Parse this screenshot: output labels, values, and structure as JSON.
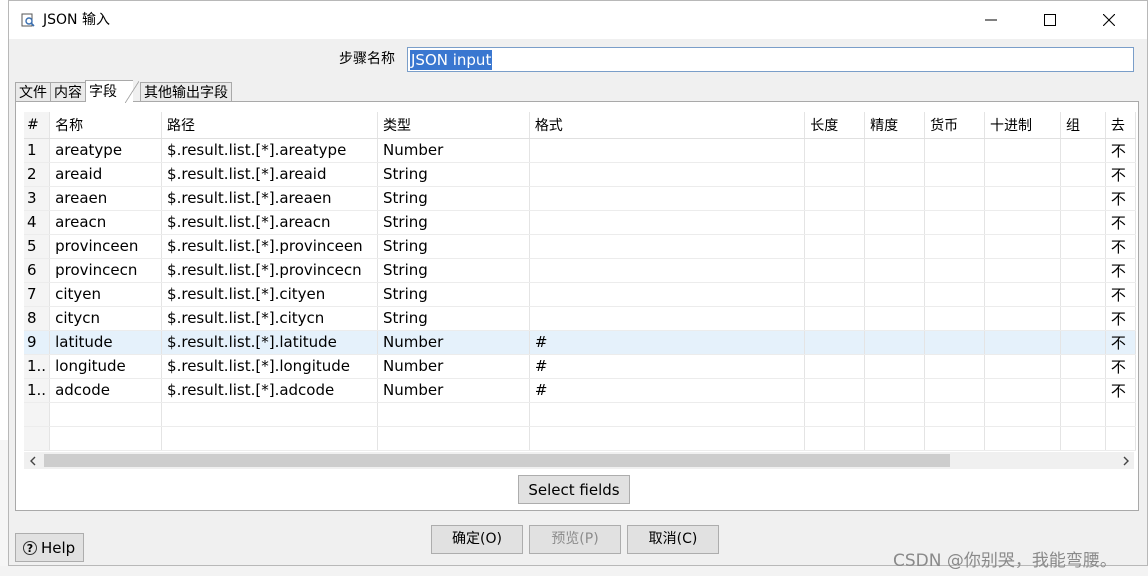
{
  "window": {
    "title": "JSON 输入"
  },
  "step": {
    "label": "步骤名称",
    "value": "JSON input"
  },
  "tabs": [
    {
      "label": "文件"
    },
    {
      "label": "内容"
    },
    {
      "label": "字段"
    },
    {
      "label": "其他输出字段"
    }
  ],
  "table": {
    "columns": [
      "#",
      "名称",
      "路径",
      "类型",
      "格式",
      "长度",
      "精度",
      "货币",
      "十进制",
      "组",
      "去"
    ],
    "rows": [
      {
        "idx": "1",
        "name": "areatype",
        "path": "$.result.list.[*].areatype",
        "type": "Number",
        "format": "",
        "trim": "不"
      },
      {
        "idx": "2",
        "name": "areaid",
        "path": "$.result.list.[*].areaid",
        "type": "String",
        "format": "",
        "trim": "不"
      },
      {
        "idx": "3",
        "name": "areaen",
        "path": "$.result.list.[*].areaen",
        "type": "String",
        "format": "",
        "trim": "不"
      },
      {
        "idx": "4",
        "name": "areacn",
        "path": "$.result.list.[*].areacn",
        "type": "String",
        "format": "",
        "trim": "不"
      },
      {
        "idx": "5",
        "name": "provinceen",
        "path": "$.result.list.[*].provinceen",
        "type": "String",
        "format": "",
        "trim": "不"
      },
      {
        "idx": "6",
        "name": "provincecn",
        "path": "$.result.list.[*].provincecn",
        "type": "String",
        "format": "",
        "trim": "不"
      },
      {
        "idx": "7",
        "name": "cityen",
        "path": "$.result.list.[*].cityen",
        "type": "String",
        "format": "",
        "trim": "不"
      },
      {
        "idx": "8",
        "name": "citycn",
        "path": "$.result.list.[*].citycn",
        "type": "String",
        "format": "",
        "trim": "不"
      },
      {
        "idx": "9",
        "name": "latitude",
        "path": "$.result.list.[*].latitude",
        "type": "Number",
        "format": "#",
        "trim": "不"
      },
      {
        "idx": "1..",
        "name": "longitude",
        "path": "$.result.list.[*].longitude",
        "type": "Number",
        "format": "#",
        "trim": "不"
      },
      {
        "idx": "1..",
        "name": "adcode",
        "path": "$.result.list.[*].adcode",
        "type": "Number",
        "format": "#",
        "trim": "不"
      }
    ],
    "highlighted_row": 9
  },
  "buttons": {
    "select_fields": "Select fields",
    "help": "Help",
    "ok": "确定(O)",
    "preview": "预览(P)",
    "cancel": "取消(C)"
  },
  "watermark": "CSDN @你别哭，我能弯腰。",
  "colors": {
    "selection": "#3a77d0",
    "row_highlight": "#e5f1fb"
  }
}
